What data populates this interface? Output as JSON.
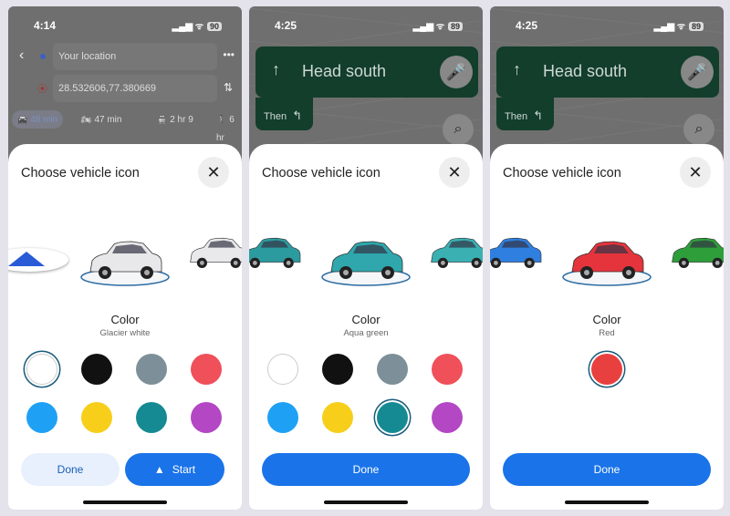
{
  "panels": [
    {
      "status": {
        "time": "4:14",
        "battery": "90"
      },
      "directions": {
        "origin": "Your location",
        "destination": "28.532606,77.380669",
        "modes": [
          {
            "icon": "car-icon",
            "label": "48 min"
          },
          {
            "icon": "motorcycle-icon",
            "label": "47 min"
          },
          {
            "icon": "transit-icon",
            "label": "2 hr 9"
          },
          {
            "icon": "walk-icon",
            "label": "6 hr"
          }
        ]
      },
      "sheet": {
        "title": "Choose vehicle icon",
        "color_label": "Color",
        "color_name": "Glacier white"
      },
      "cars": [
        "#2a5bd7",
        "#e8e8ea",
        "#e9e9ec"
      ],
      "swatches": [
        "#ffffff",
        "#111111",
        "#7d8f98",
        "#f0505a",
        "#1ea1f5",
        "#f7cf1a",
        "#158a93",
        "#b347c4"
      ],
      "selected": 0,
      "buttons": {
        "done": "Done",
        "start": "Start"
      }
    },
    {
      "status": {
        "time": "4:25",
        "battery": "89"
      },
      "nav": {
        "instruction": "Head south",
        "then": "Then"
      },
      "sheet": {
        "title": "Choose vehicle icon",
        "color_label": "Color",
        "color_name": "Aqua green"
      },
      "cars": [
        "#2c9b9f",
        "#2fa7ad",
        "#3ab0b2"
      ],
      "swatches": [
        "#ffffff",
        "#111111",
        "#7d8f98",
        "#f0505a",
        "#1ea1f5",
        "#f7cf1a",
        "#158a93",
        "#b347c4"
      ],
      "selected": 6,
      "buttons": {
        "done": "Done"
      }
    },
    {
      "status": {
        "time": "4:25",
        "battery": "89"
      },
      "nav": {
        "instruction": "Head south",
        "then": "Then"
      },
      "sheet": {
        "title": "Choose vehicle icon",
        "color_label": "Color",
        "color_name": "Red"
      },
      "cars": [
        "#2f7fe0",
        "#e5343c",
        "#2e9e3a"
      ],
      "swatches": [
        "#e8403f"
      ],
      "selected": 0,
      "buttons": {
        "done": "Done"
      }
    }
  ],
  "colors": {
    "accent": "#1a73e8",
    "done_light": "#e8f0fe"
  }
}
